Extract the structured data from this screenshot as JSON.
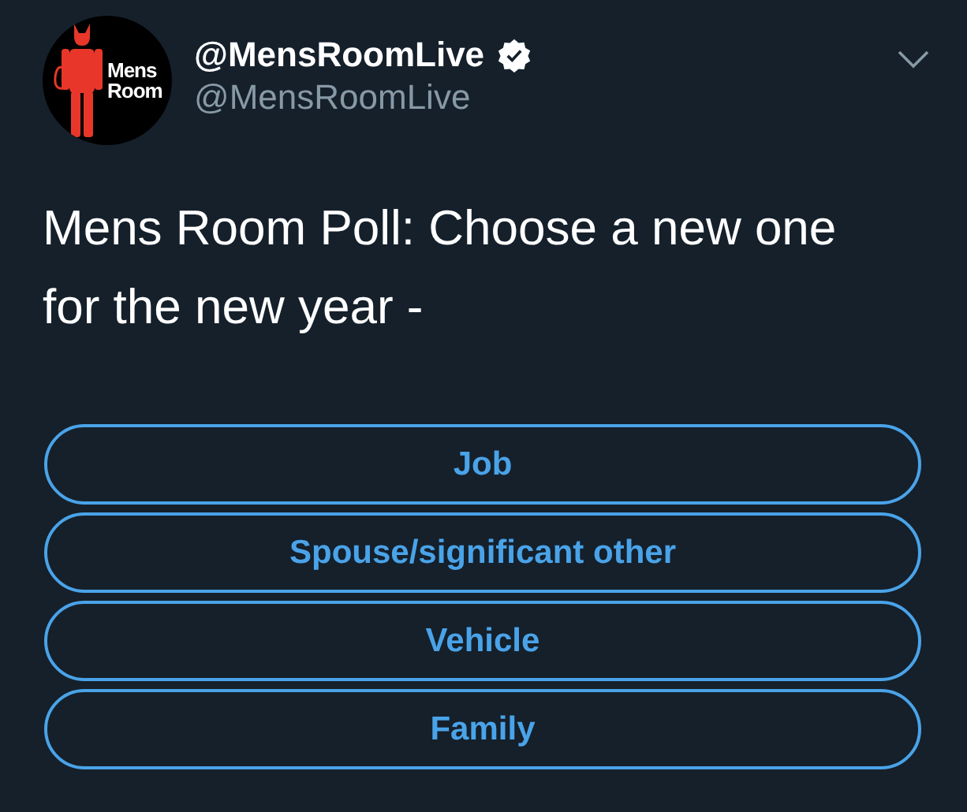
{
  "author": {
    "avatar_text": [
      "Mens",
      "Room"
    ],
    "display_name": "@MensRoomLive",
    "verified": true,
    "handle": "@MensRoomLive"
  },
  "tweet_text": "Mens Room Poll: Choose a new one for the new year -",
  "poll": {
    "options": [
      {
        "label": "Job"
      },
      {
        "label": "Spouse/significant other"
      },
      {
        "label": "Vehicle"
      },
      {
        "label": "Family"
      }
    ]
  }
}
